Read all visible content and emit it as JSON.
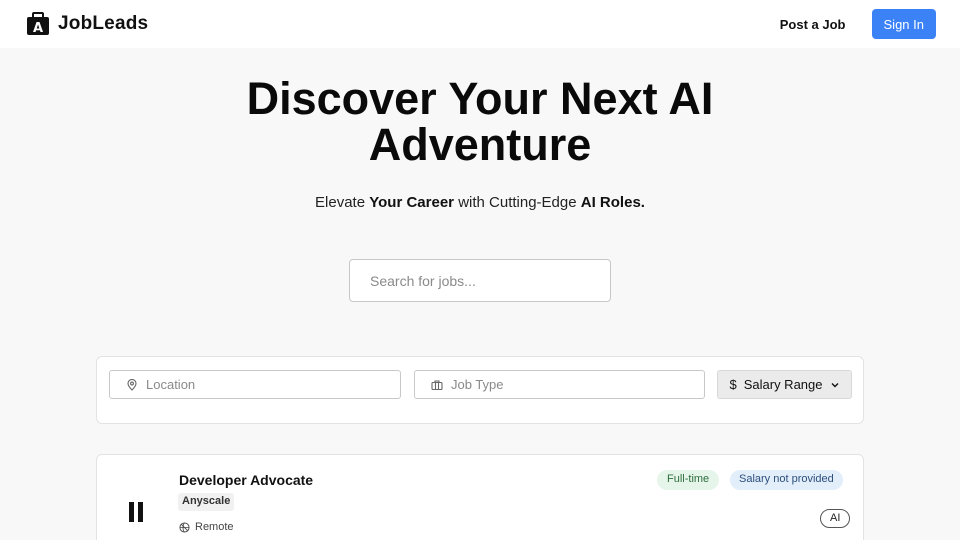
{
  "header": {
    "brand": "JobLeads",
    "brand_icon": "briefcase-icon",
    "post_job": "Post a Job",
    "sign_in": "Sign In"
  },
  "hero": {
    "title_line1": "Discover Your Next AI",
    "title_line2": "Adventure",
    "subtitle": {
      "part1": "Elevate",
      "bold1": "Your Career",
      "part2": "with Cutting-Edge",
      "bold2": "AI Roles."
    },
    "search_placeholder": "Search for jobs..."
  },
  "filters": {
    "location_placeholder": "Location",
    "location_icon": "map-pin-icon",
    "job_type_placeholder": "Job Type",
    "job_type_icon": "briefcase-icon",
    "salary_label": "Salary Range",
    "salary_icon": "dollar-icon",
    "salary_chevron": "chevron-down-icon"
  },
  "jobs": [
    {
      "title": "Developer Advocate",
      "company": "Anyscale",
      "location": "Remote",
      "location_icon": "remote-icon",
      "type": "Full-time",
      "salary": "Salary not provided",
      "tag": "AI"
    }
  ],
  "colors": {
    "accent": "#3b82f6",
    "background": "#f8f8f8",
    "fulltime_badge": "#e6f5ea",
    "salary_badge": "#e3eefb"
  }
}
